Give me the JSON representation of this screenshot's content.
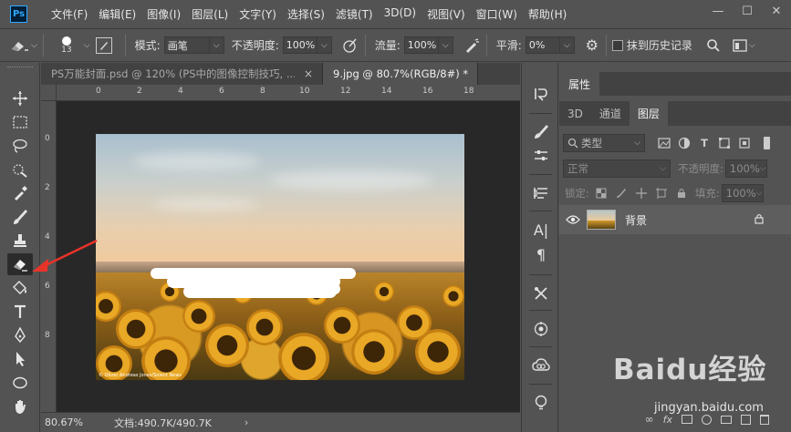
{
  "app": {
    "logo": "Ps"
  },
  "menu": [
    "文件(F)",
    "编辑(E)",
    "图像(I)",
    "图层(L)",
    "文字(Y)",
    "选择(S)",
    "滤镜(T)",
    "3D(D)",
    "视图(V)",
    "窗口(W)",
    "帮助(H)"
  ],
  "window_controls": {
    "minimize": "—",
    "maximize": "☐",
    "close": "✕"
  },
  "options": {
    "brush_size": "13",
    "mode_label": "模式:",
    "mode_value": "画笔",
    "opacity_label": "不透明度:",
    "opacity_value": "100%",
    "flow_label": "流量:",
    "flow_value": "100%",
    "smooth_label": "平滑:",
    "smooth_value": "0%",
    "history_label": "抹到历史记录"
  },
  "tabs": [
    {
      "label": "PS万能封面.psd @ 120% (PS中的图像控制技巧, ...",
      "close": "×"
    },
    {
      "label": "9.jpg @ 80.7%(RGB/8#) *",
      "close": "×"
    }
  ],
  "ruler": {
    "h": [
      "0",
      "2",
      "4",
      "6",
      "8",
      "10",
      "12",
      "14",
      "16",
      "18"
    ],
    "v": [
      "0",
      "2",
      "4",
      "6",
      "8"
    ]
  },
  "photo": {
    "credit": "© Oliver Andreas Jones/Solent News"
  },
  "status": {
    "zoom": "80.67%",
    "doc": "文档:490.7K/490.7K",
    "arrow": "›"
  },
  "panel": {
    "header": "属性",
    "tabs": [
      "3D",
      "通道",
      "图层"
    ],
    "filter_label": "类型",
    "blend_mode": "正常",
    "opacity_label": "不透明度:",
    "opacity_value": "100%",
    "lock_label": "锁定:",
    "fill_label": "填充:",
    "fill_value": "100%",
    "layer_name": "背景"
  },
  "watermark": {
    "brand": "Baidu经验",
    "url": "jingyan.baidu.com"
  },
  "colors": {
    "annotation_arrow": "#e8332a",
    "ps_blue": "#31a8ff"
  }
}
